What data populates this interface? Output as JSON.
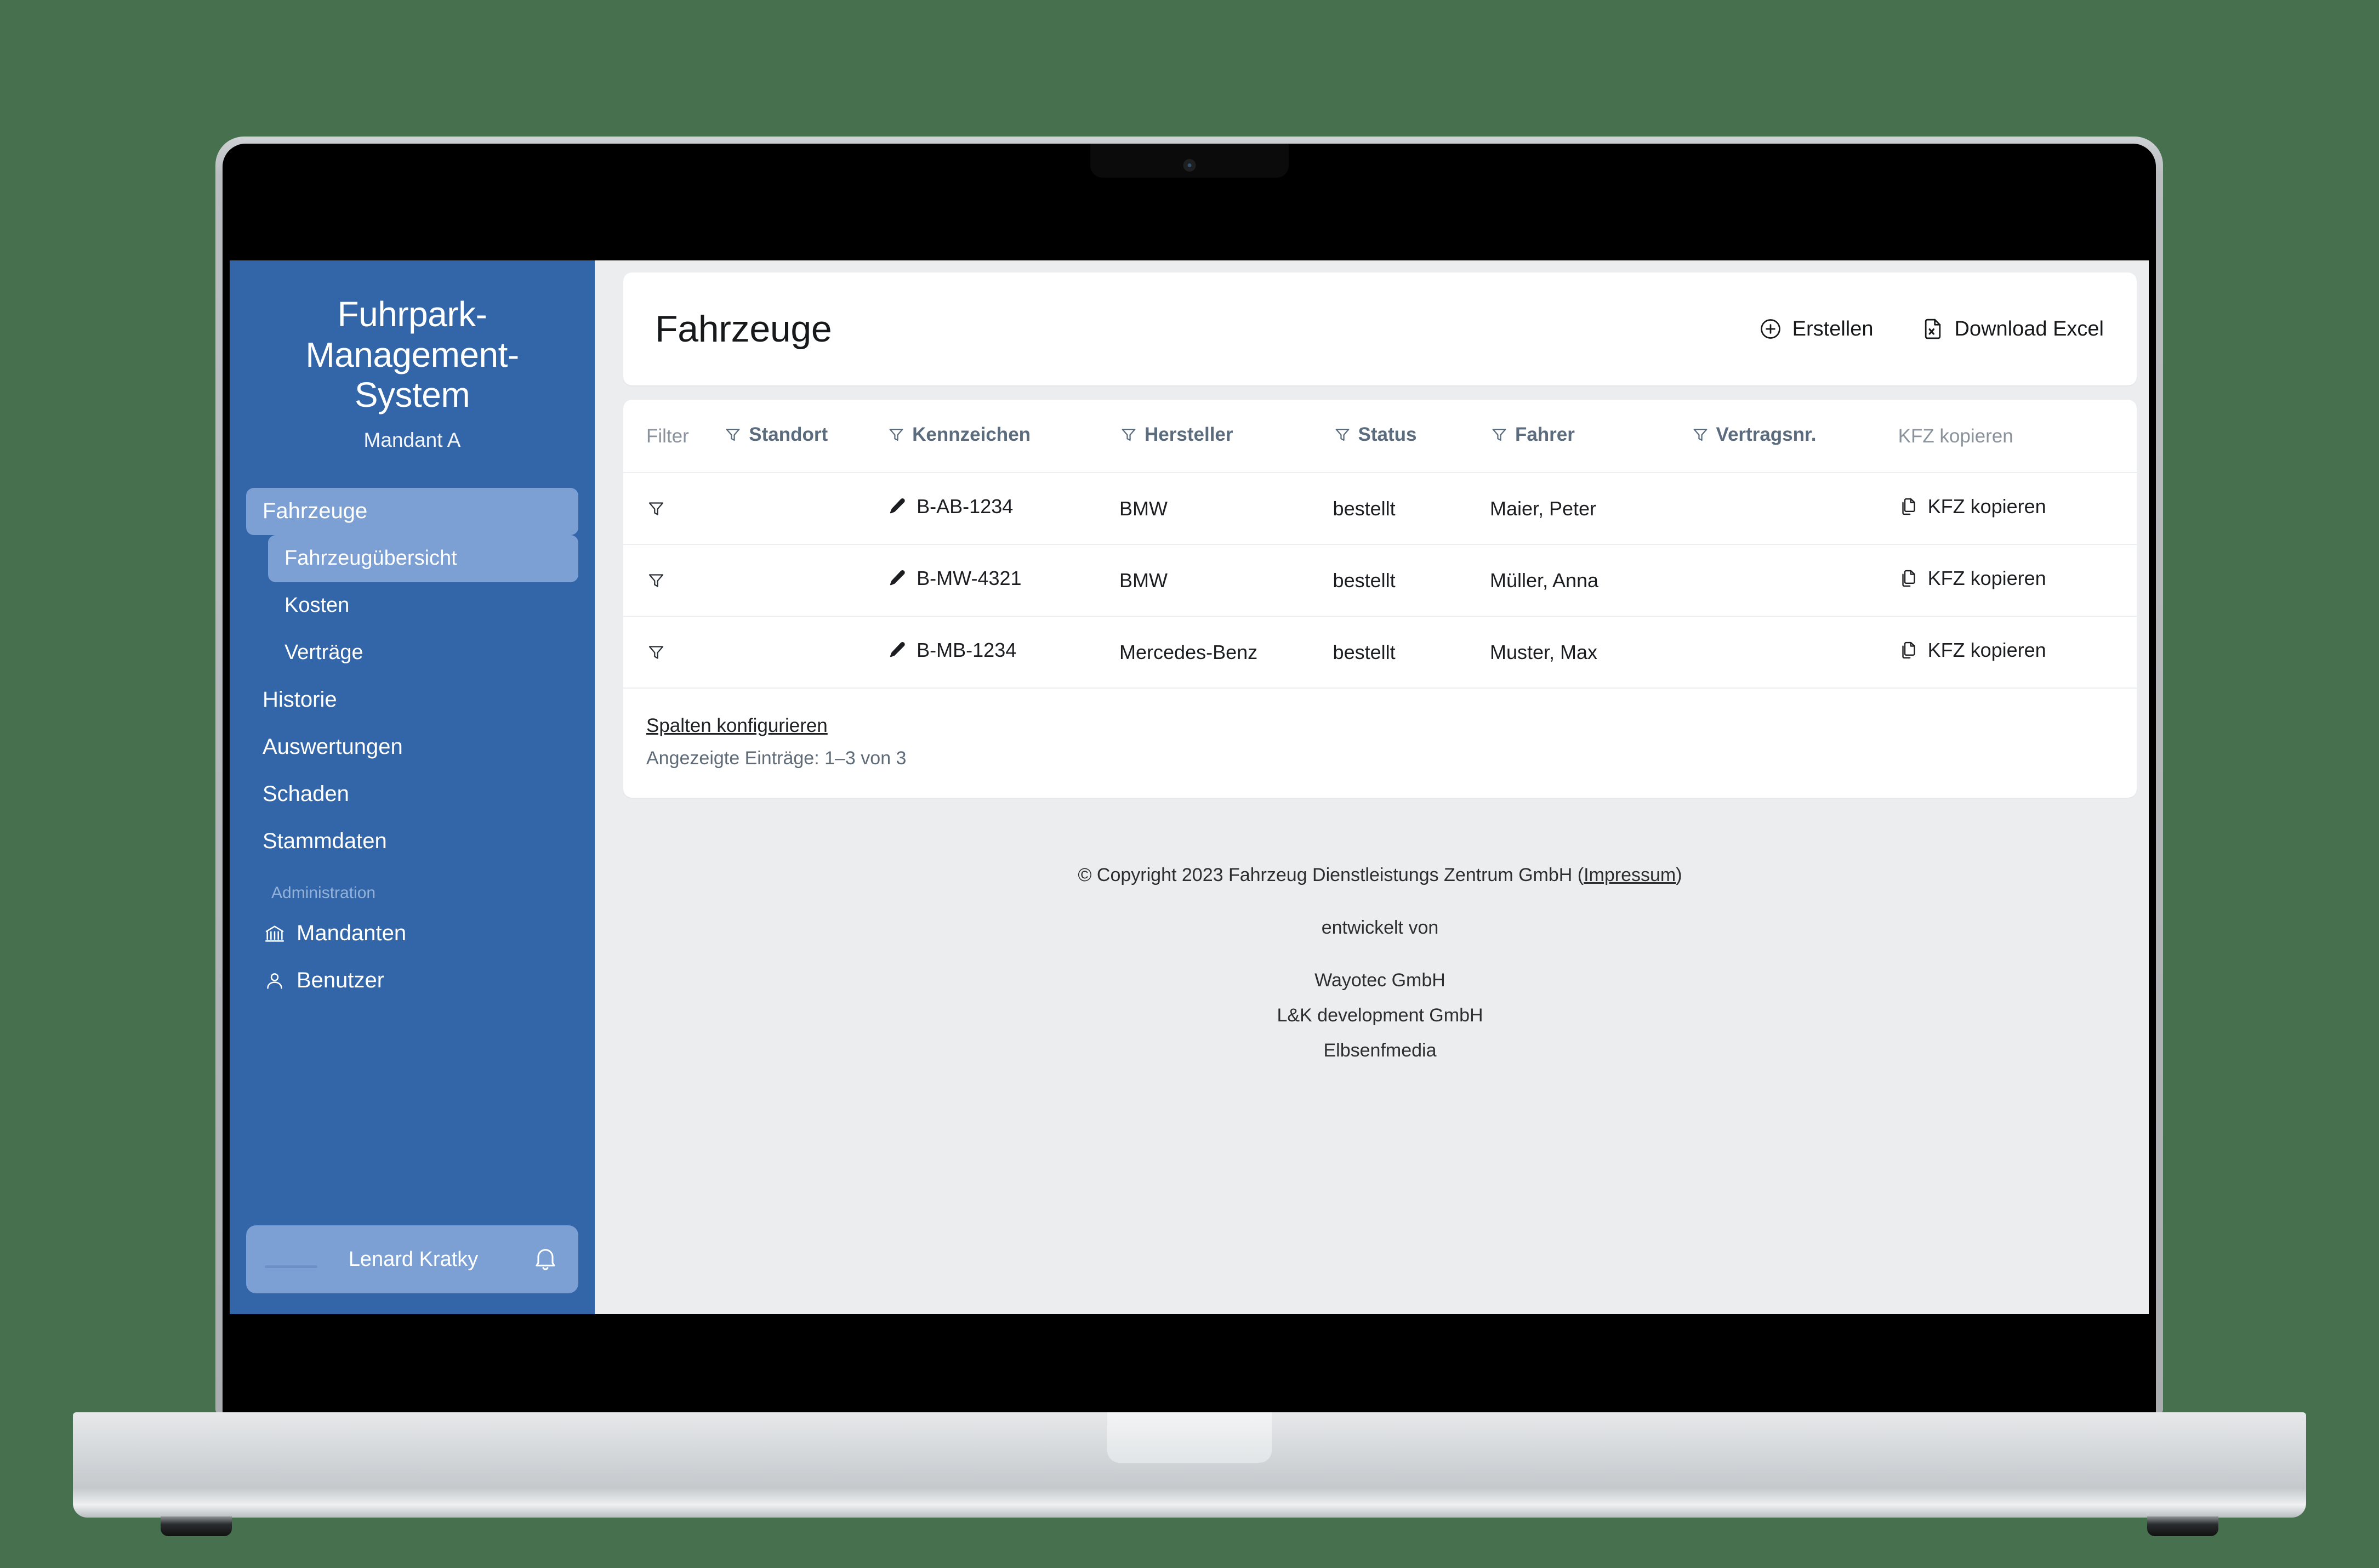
{
  "sidebar": {
    "brand_title": "Fuhrpark-Management-System",
    "brand_subtitle": "Mandant A",
    "items": [
      {
        "label": "Fahrzeuge",
        "level": "parent",
        "active": true
      },
      {
        "label": "Fahrzeugübersicht",
        "level": "child",
        "active": true
      },
      {
        "label": "Kosten",
        "level": "child",
        "active": false
      },
      {
        "label": "Verträge",
        "level": "child",
        "active": false
      },
      {
        "label": "Historie",
        "level": "parent",
        "active": false
      },
      {
        "label": "Auswertungen",
        "level": "parent",
        "active": false
      },
      {
        "label": "Schaden",
        "level": "parent",
        "active": false
      },
      {
        "label": "Stammdaten",
        "level": "parent",
        "active": false
      }
    ],
    "section_label": "Administration",
    "admin_items": [
      {
        "label": "Mandanten",
        "icon": "bank-icon"
      },
      {
        "label": "Benutzer",
        "icon": "user-icon"
      }
    ],
    "user": {
      "name": "Lenard Kratky",
      "bell_icon": "bell-icon"
    },
    "colors": {
      "background": "#3366a8",
      "active": "#7ca0d4",
      "section_text": "#93b2d9"
    }
  },
  "header": {
    "title": "Fahrzeuge",
    "actions": [
      {
        "label": "Erstellen",
        "icon": "plus-circle-icon"
      },
      {
        "label": "Download Excel",
        "icon": "file-excel-icon"
      }
    ]
  },
  "table": {
    "columns": [
      {
        "label": "Filter",
        "filterable": false,
        "key": "filter"
      },
      {
        "label": "Standort",
        "filterable": true,
        "key": "standort"
      },
      {
        "label": "Kennzeichen",
        "filterable": true,
        "key": "kennzeichen"
      },
      {
        "label": "Hersteller",
        "filterable": true,
        "key": "hersteller"
      },
      {
        "label": "Status",
        "filterable": true,
        "key": "status"
      },
      {
        "label": "Fahrer",
        "filterable": true,
        "key": "fahrer"
      },
      {
        "label": "Vertragsnr.",
        "filterable": true,
        "key": "vertragsnr"
      },
      {
        "label": "KFZ kopieren",
        "filterable": false,
        "key": "kopieren"
      }
    ],
    "rows": [
      {
        "standort": "",
        "kennzeichen": "B-AB-1234",
        "hersteller": "BMW",
        "status": "bestellt",
        "fahrer": "Maier, Peter",
        "vertragsnr": "",
        "kopieren": "KFZ kopieren"
      },
      {
        "standort": "",
        "kennzeichen": "B-MW-4321",
        "hersteller": "BMW",
        "status": "bestellt",
        "fahrer": "Müller, Anna",
        "vertragsnr": "",
        "kopieren": "KFZ kopieren"
      },
      {
        "standort": "",
        "kennzeichen": "B-MB-1234",
        "hersteller": "Mercedes-Benz",
        "status": "bestellt",
        "fahrer": "Muster, Max",
        "vertragsnr": "",
        "kopieren": "KFZ kopieren"
      }
    ],
    "configure_link": "Spalten konfigurieren",
    "entries_info": "Angezeigte Einträge: 1–3 von 3"
  },
  "footer": {
    "copyright_prefix": "© Copyright 2023 Fahrzeug Dienstleistungs Zentrum GmbH (",
    "imprint_label": "Impressum",
    "copyright_suffix": ")",
    "developed_by": "entwickelt von",
    "developers": [
      "Wayotec GmbH",
      "L&K development GmbH",
      "Elbsenfmedia"
    ]
  },
  "theme": {
    "page_background": "#47704e",
    "content_background": "#ecedef",
    "card_background": "#ffffff",
    "header_text": "#5a6c7d"
  }
}
